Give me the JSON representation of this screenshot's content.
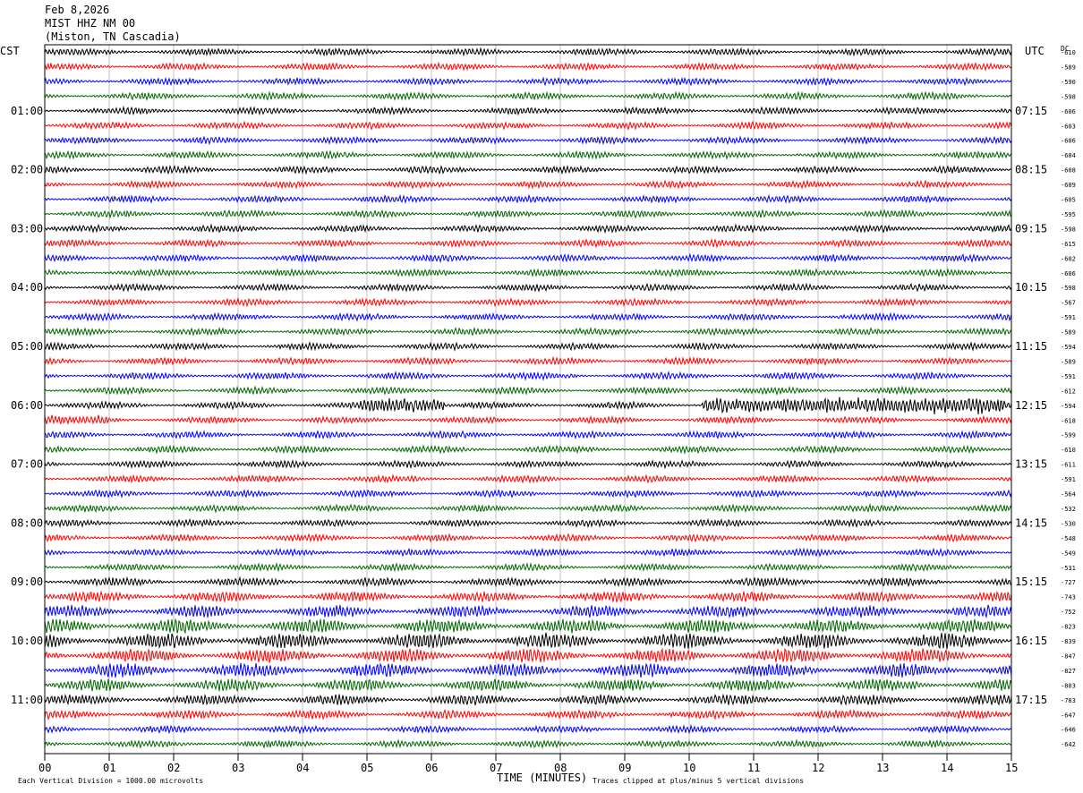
{
  "header": {
    "date": "Feb 8,2026",
    "station": "MIST HHZ NM 00",
    "location": "(Miston, TN Cascadia)"
  },
  "left_tz": "CST",
  "right_tz": "UTC",
  "dc_label": "DC",
  "footer": {
    "scale_note": "Each Vertical Division = 1000.00 microvolts",
    "clip_note": "Traces clipped at plus/minus 5 vertical divisions"
  },
  "chart_data": {
    "type": "line",
    "xlabel": "TIME (MINUTES)",
    "xlim": [
      0,
      15
    ],
    "x_ticks": [
      "00",
      "01",
      "02",
      "03",
      "04",
      "05",
      "06",
      "07",
      "08",
      "09",
      "10",
      "11",
      "12",
      "13",
      "14",
      "15"
    ],
    "left_time_labels": [
      "01:00",
      "02:00",
      "03:00",
      "04:00",
      "05:00",
      "06:00",
      "07:00",
      "08:00",
      "09:00",
      "10:00",
      "11:00"
    ],
    "right_time_labels": [
      "07:15",
      "08:15",
      "09:15",
      "10:15",
      "11:15",
      "12:15",
      "13:15",
      "14:15",
      "15:15",
      "16:15",
      "17:15"
    ],
    "trace_colors": [
      "#000000",
      "#ff0000",
      "#0000ff",
      "#006600"
    ],
    "dc_offsets": [
      "-610",
      "-589",
      "-590",
      "-598",
      "-606",
      "-603",
      "-606",
      "-604",
      "-608",
      "-609",
      "-605",
      "-595",
      "-598",
      "-615",
      "-602",
      "-606",
      "-598",
      "-567",
      "-591",
      "-589",
      "-594",
      "-589",
      "-591",
      "-612",
      "-594",
      "-618",
      "-599",
      "-610",
      "-611",
      "-591",
      "-564",
      "-532",
      "-530",
      "-548",
      "-549",
      "-531",
      "-727",
      "-743",
      "-752",
      "-823",
      "-839",
      "-847",
      "-827",
      "-803",
      "-783",
      "-647",
      "-646",
      "-642"
    ],
    "trace_amplitude": [
      2,
      2,
      2,
      2,
      2,
      2,
      2,
      2,
      2,
      2,
      2,
      2,
      2,
      2,
      2,
      2,
      2,
      2,
      2,
      2,
      2,
      2,
      2,
      2,
      2,
      2,
      2,
      2,
      2,
      2,
      2,
      2,
      2,
      2,
      2,
      2,
      2.5,
      3,
      3.5,
      4,
      4.5,
      4,
      4,
      3.5,
      3,
      2.5,
      2,
      2
    ],
    "events": [
      {
        "trace": 24,
        "start_min": 4.9,
        "end_min": 6.2,
        "peak_divisions": 5
      },
      {
        "trace": 24,
        "start_min": 10.2,
        "end_min": 14.9,
        "peak_divisions": 5
      },
      {
        "trace": 25,
        "start_min": 0.0,
        "end_min": 1.0,
        "peak_divisions": 3
      }
    ]
  }
}
